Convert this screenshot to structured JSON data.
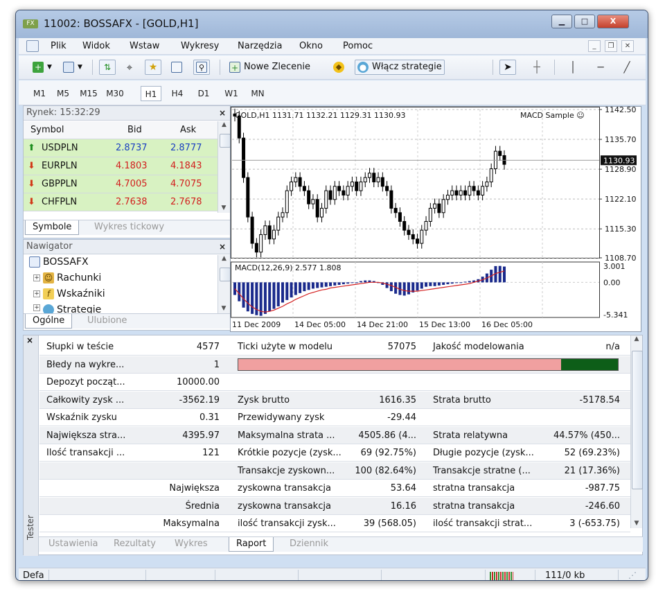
{
  "window": {
    "title": "11002: BOSSAFX - [GOLD,H1]",
    "app_icon": "FX"
  },
  "window_controls": {
    "minimize": "▁",
    "maximize": "□",
    "close": "X"
  },
  "menu": {
    "items": [
      "Plik",
      "Widok",
      "Wstaw",
      "Wykresy",
      "Narzędzia",
      "Okno",
      "Pomoc"
    ]
  },
  "mdi_controls": {
    "minimize": "_",
    "restore": "❐",
    "close": "✕"
  },
  "toolbar": {
    "new_order": "Nowe Zlecenie",
    "strategies": "Włącz strategie"
  },
  "timeframes": {
    "items": [
      "M1",
      "M5",
      "M15",
      "M30",
      "H1",
      "H4",
      "D1",
      "W1",
      "MN"
    ],
    "active": "H1"
  },
  "market": {
    "title": "Rynek: 15:32:29",
    "columns": {
      "symbol": "Symbol",
      "bid": "Bid",
      "ask": "Ask"
    },
    "rows": [
      {
        "symbol": "USDPLN",
        "bid": "2.8737",
        "ask": "2.8777",
        "dir": "up"
      },
      {
        "symbol": "EURPLN",
        "bid": "4.1803",
        "ask": "4.1843",
        "dir": "down"
      },
      {
        "symbol": "GBPPLN",
        "bid": "4.7005",
        "ask": "4.7075",
        "dir": "down"
      },
      {
        "symbol": "CHFPLN",
        "bid": "2.7638",
        "ask": "2.7678",
        "dir": "down"
      }
    ],
    "tabs": [
      "Symbole",
      "Wykres tickowy"
    ]
  },
  "navigator": {
    "title": "Nawigator",
    "root": "BOSSAFX",
    "items": [
      "Rachunki",
      "Wskaźniki",
      "Strategie"
    ],
    "tabs": [
      "Ogólne",
      "Ulubione"
    ]
  },
  "chart": {
    "header": "GOLD,H1  1131.71 1132.21 1129.31 1130.93",
    "ea_label": "MACD Sample ☺",
    "price_labels": [
      "1142.50",
      "1135.70",
      "1128.90",
      "1122.10",
      "1115.30",
      "1108.70"
    ],
    "current_price": "1130.93",
    "macd_header": "MACD(12,26,9) 2.577 1.808",
    "macd_labels": [
      "3.001",
      "0.00",
      "-5.341"
    ],
    "date_labels": [
      "11 Dec 2009",
      "14 Dec 05:00",
      "14 Dec 21:00",
      "15 Dec 13:00",
      "16 Dec 05:00"
    ],
    "colors": {
      "up_candle": "#ffffff",
      "down_candle": "#000000",
      "macd_bars": "#1a2a8c",
      "signal": "#d42020"
    }
  },
  "chart_data": {
    "type": "candlestick",
    "title": "GOLD,H1",
    "ylim": [
      1108.7,
      1142.5
    ],
    "close_series": [
      1141,
      1136,
      1127,
      1118,
      1112,
      1110,
      1114,
      1116,
      1113,
      1115,
      1118,
      1119,
      1124,
      1126,
      1127,
      1125,
      1124,
      1121,
      1122,
      1118,
      1120,
      1124,
      1122,
      1125,
      1124,
      1123,
      1125,
      1126,
      1124,
      1126,
      1127,
      1128,
      1126,
      1127,
      1125,
      1124,
      1120,
      1119,
      1117,
      1115,
      1114,
      1113,
      1112,
      1115,
      1117,
      1120,
      1121,
      1119,
      1122,
      1123,
      1124,
      1123,
      1124,
      1123,
      1125,
      1124,
      1123,
      1125,
      1126,
      1129,
      1133,
      1132,
      1130
    ],
    "macd_ylim": [
      -5.341,
      3.001
    ],
    "macd_series": [
      -2,
      -3,
      -4,
      -4.6,
      -5,
      -5.2,
      -5.3,
      -5,
      -4.6,
      -4.2,
      -3.8,
      -3.2,
      -2.8,
      -2.4,
      -2,
      -1.7,
      -1.4,
      -1.2,
      -1,
      -0.9,
      -0.8,
      -0.7,
      -0.6,
      -0.5,
      -0.4,
      -0.3,
      -0.2,
      -0.1,
      0,
      0.2,
      0.3,
      0.3,
      0.2,
      0,
      -0.4,
      -0.9,
      -1.4,
      -1.8,
      -2,
      -2.1,
      -1.9,
      -1.6,
      -1.3,
      -1,
      -0.7,
      -0.6,
      -0.6,
      -0.5,
      -0.4,
      -0.3,
      -0.2,
      -0.1,
      0,
      0.1,
      0.2,
      0.3,
      0.5,
      0.9,
      1.4,
      2,
      2.577,
      2.6,
      2.5
    ],
    "signal_series": [
      -1,
      -1.8,
      -2.6,
      -3.3,
      -3.9,
      -4.3,
      -4.6,
      -4.7,
      -4.6,
      -4.4,
      -4.1,
      -3.8,
      -3.4,
      -3.1,
      -2.7,
      -2.4,
      -2.1,
      -1.8,
      -1.6,
      -1.4,
      -1.2,
      -1.1,
      -0.9,
      -0.8,
      -0.7,
      -0.6,
      -0.5,
      -0.4,
      -0.3,
      -0.2,
      -0.1,
      0,
      0,
      0,
      -0.1,
      -0.3,
      -0.5,
      -0.8,
      -1.1,
      -1.3,
      -1.4,
      -1.4,
      -1.4,
      -1.3,
      -1.2,
      -1.1,
      -1,
      -0.9,
      -0.8,
      -0.7,
      -0.6,
      -0.5,
      -0.4,
      -0.3,
      -0.2,
      0,
      0.2,
      0.4,
      0.7,
      1,
      1.4,
      1.6,
      1.808
    ]
  },
  "tester": {
    "side_label": "Tester",
    "rows": [
      [
        "Słupki w teście",
        "4577",
        "Ticki użyte w modelu",
        "57075",
        "Jakość modelowania",
        "n/a"
      ],
      [
        "Błedy na wykre...",
        "1",
        "",
        "",
        "",
        ""
      ],
      [
        "Depozyt począt...",
        "10000.00",
        "",
        "",
        "",
        ""
      ],
      [
        "Całkowity zysk ...",
        "-3562.19",
        "Zysk brutto",
        "1616.35",
        "Strata brutto",
        "-5178.54"
      ],
      [
        "Wskaźnik zysku",
        "0.31",
        "Przewidywany zysk",
        "-29.44",
        "",
        ""
      ],
      [
        "Największa stra...",
        "4395.97",
        "Maksymalna strata ...",
        "4505.86 (4...",
        "Strata relatywna",
        "44.57% (450..."
      ],
      [
        "Ilość transakcji ...",
        "121",
        "Krótkie pozycje (zysk...",
        "69 (92.75%)",
        "Długie pozycje (zysk...",
        "52 (69.23%)"
      ],
      [
        "",
        "",
        "Transakcje zyskown...",
        "100 (82.64%)",
        "Transakcje stratne (...",
        "21 (17.36%)"
      ],
      [
        "",
        "Największa",
        "zyskowna transakcja",
        "53.64",
        "stratna transakcja",
        "-987.75"
      ],
      [
        "",
        "Średnia",
        "zyskowna transakcja",
        "16.16",
        "stratna transakcja",
        "-246.60"
      ],
      [
        "",
        "Maksymalna",
        "ilość transakcji zysk...",
        "39 (568.05)",
        "ilość transakcji strat...",
        "3 (-653.75)"
      ]
    ],
    "quality_bar_fraction": 0.85,
    "tabs": [
      "Ustawienia",
      "Rezultaty",
      "Wykres",
      "Raport",
      "Dziennik"
    ],
    "active_tab": "Raport"
  },
  "status": {
    "left": "Defa",
    "traffic": "111/0 kb"
  }
}
